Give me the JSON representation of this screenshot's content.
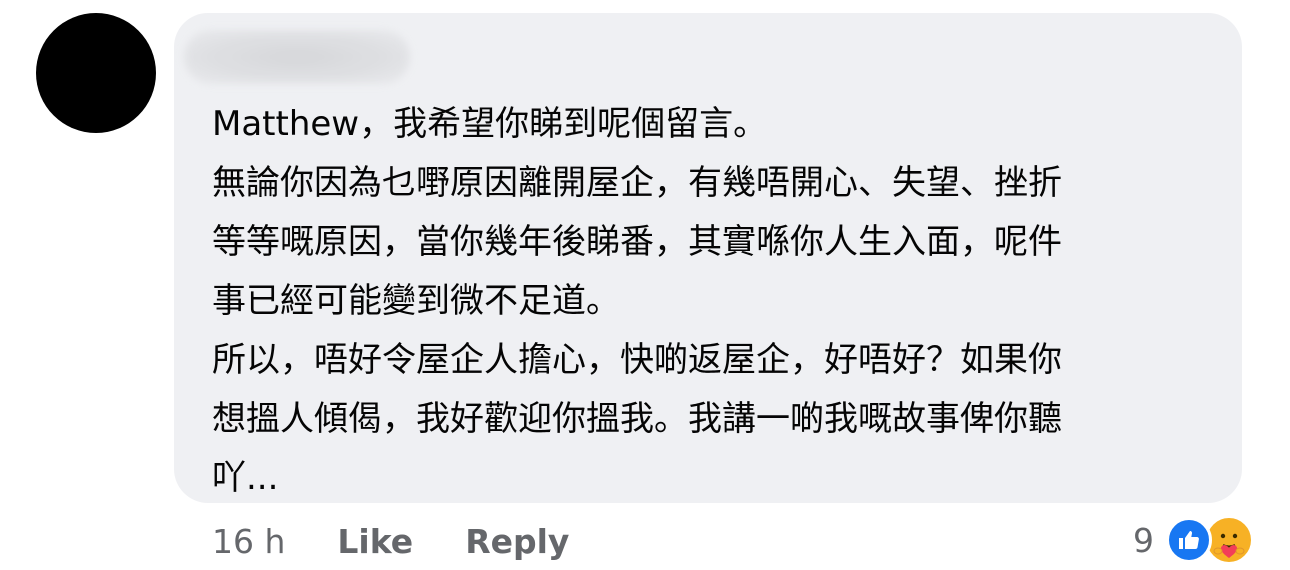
{
  "comment": {
    "lines": [
      "Matthew，我希望你睇到呢個留言。",
      "無論你因為乜嘢原因離開屋企，有幾唔開心、失望、挫折",
      "等等嘅原因，當你幾年後睇番，其實喺你人生入面，呢件",
      "事已經可能變到微不足道。",
      "所以，唔好令屋企人擔心，快啲返屋企，好唔好？如果你",
      "想搵人傾偈，我好歡迎你搵我。我講一啲我嘅故事俾你聽",
      "吖..."
    ]
  },
  "actions": {
    "time": "16 h",
    "like_label": "Like",
    "reply_label": "Reply"
  },
  "reactions": {
    "count": "9",
    "icons": [
      "like-icon",
      "care-icon"
    ]
  },
  "colors": {
    "bubble": "#eff0f3",
    "text": "#050505",
    "meta": "#65676b",
    "like_blue": "#1877f2",
    "care_yellow": "#f7b125"
  }
}
